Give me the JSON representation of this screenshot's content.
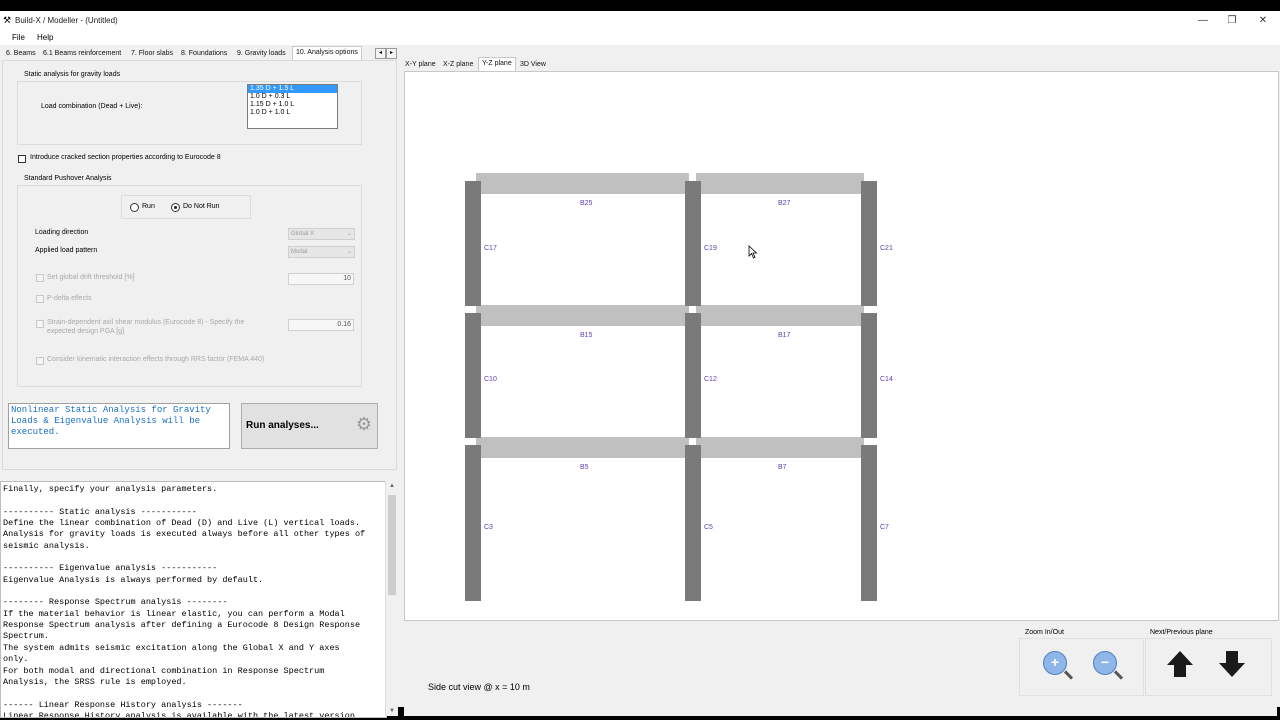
{
  "window": {
    "title": "Build-X / Modeller - (Untitled)"
  },
  "menu": [
    "File",
    "Help"
  ],
  "left_tabs": [
    "6. Beams",
    "6.1 Beams reinforcement",
    "7. Floor slabs",
    "8. Foundations",
    "9. Gravity loads",
    "10. Analysis options"
  ],
  "analysis": {
    "static_group_title": "Static analysis for gravity loads",
    "load_combination_label": "Load combination (Dead + Live):",
    "load_combinations": [
      "1.35 D + 1.5 L",
      "1.0 D  + 0.3 L",
      "1.15 D + 1.0 L",
      "1.0 D   + 1.0 L"
    ],
    "cracked_label": "Introduce cracked section properties according to Eurocode 8",
    "pushover_title": "Standard Pushover Analysis",
    "run_label": "Run",
    "donot_label": "Do Not Run",
    "loading_direction_label": "Loading direction",
    "loading_direction_value": "Global X",
    "applied_pattern_label": "Applied load pattern",
    "applied_pattern_value": "Modal",
    "drift_label": "Set global drift threshold [%]",
    "drift_value": "10",
    "pdelta_label": "P-delta effects",
    "strain_label_1": "Strain-dependent axil shear modulus (Eurocode 8) - Specify the",
    "strain_label_2": "expected design PGA [g]",
    "strain_value": "0.16",
    "kinematic_label": "Consider kinematic interaction effects through RRS factor (FEMA 440)"
  },
  "info_text": [
    "Nonlinear Static Analysis for Gravity",
    "Loads & Eigenvalue Analysis will be",
    "executed."
  ],
  "run_button": "Run analyses...",
  "console_lines": [
    "Finally, specify your analysis parameters.",
    "",
    "---------- Static analysis -----------",
    "Define the linear combination of Dead (D) and Live (L) vertical loads.",
    "Analysis for gravity loads is executed always before all other types of",
    "seismic analysis.",
    "",
    "---------- Eigenvalue analysis -----------",
    "Eigenvalue Analysis is always performed by default.",
    "",
    "-------- Response Spectrum analysis --------",
    "If the material behavior is linear elastic, you can perform a Modal",
    "Response Spectrum analysis after defining a Eurocode 8 Design Response",
    "Spectrum.",
    "The system admits seismic excitation along the Global X and Y axes",
    "only.",
    "For both modal and directional combination in Response Spectrum",
    "Analysis, the SRSS rule is employed.",
    "",
    "------ Linear Response History analysis -------",
    "Linear Response History analysis is available with the latest version"
  ],
  "view_tabs": [
    "X-Y plane",
    "X-Z plane",
    "Y-Z plane",
    "3D View"
  ],
  "view_selected": "Y-Z plane",
  "frame": {
    "columns": [
      "C17",
      "C19",
      "C21",
      "C10",
      "C12",
      "C14",
      "C3",
      "C5",
      "C7"
    ],
    "beams": [
      "B25",
      "B27",
      "B15",
      "B17",
      "B5",
      "B7"
    ]
  },
  "side_cut": "Side cut view @ x = 10 m",
  "zoom_title": "Zoom In/Out",
  "plane_title": "Next/Previous plane",
  "icons": [
    "app-icon",
    "zoom-in-icon",
    "zoom-out-icon",
    "arrow-up-icon",
    "arrow-down-icon",
    "gear-icon",
    "cursor-icon"
  ],
  "colors": {
    "info_text": "#1a6fc4",
    "label": "#6040b0",
    "column": "#7a7a7a",
    "beam": "#c0c0c0",
    "selection": "#3399ff"
  }
}
